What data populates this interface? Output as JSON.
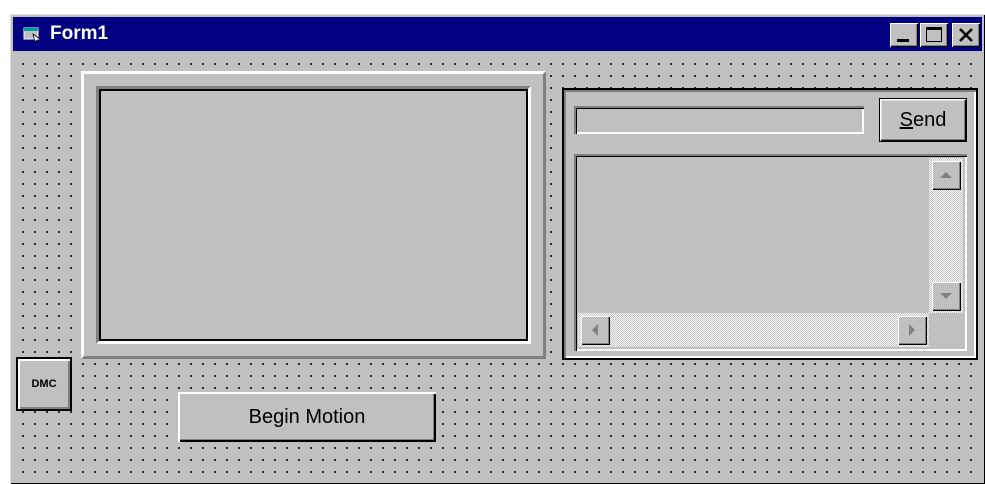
{
  "window": {
    "title": "Form1",
    "icon": "form-icon",
    "controls": [
      "minimize-icon",
      "maximize-icon",
      "close-icon"
    ]
  },
  "terminal": {
    "command_value": "",
    "send_label_accel": "S",
    "send_label_rest": "end",
    "output_text": ""
  },
  "dmc_control": {
    "label": "DMC"
  },
  "begin_button": {
    "label": "Begin Motion"
  },
  "colors": {
    "titlebar": "#000080",
    "face": "#c0c0c0",
    "highlight": "#ffffff",
    "shadow": "#808080"
  }
}
